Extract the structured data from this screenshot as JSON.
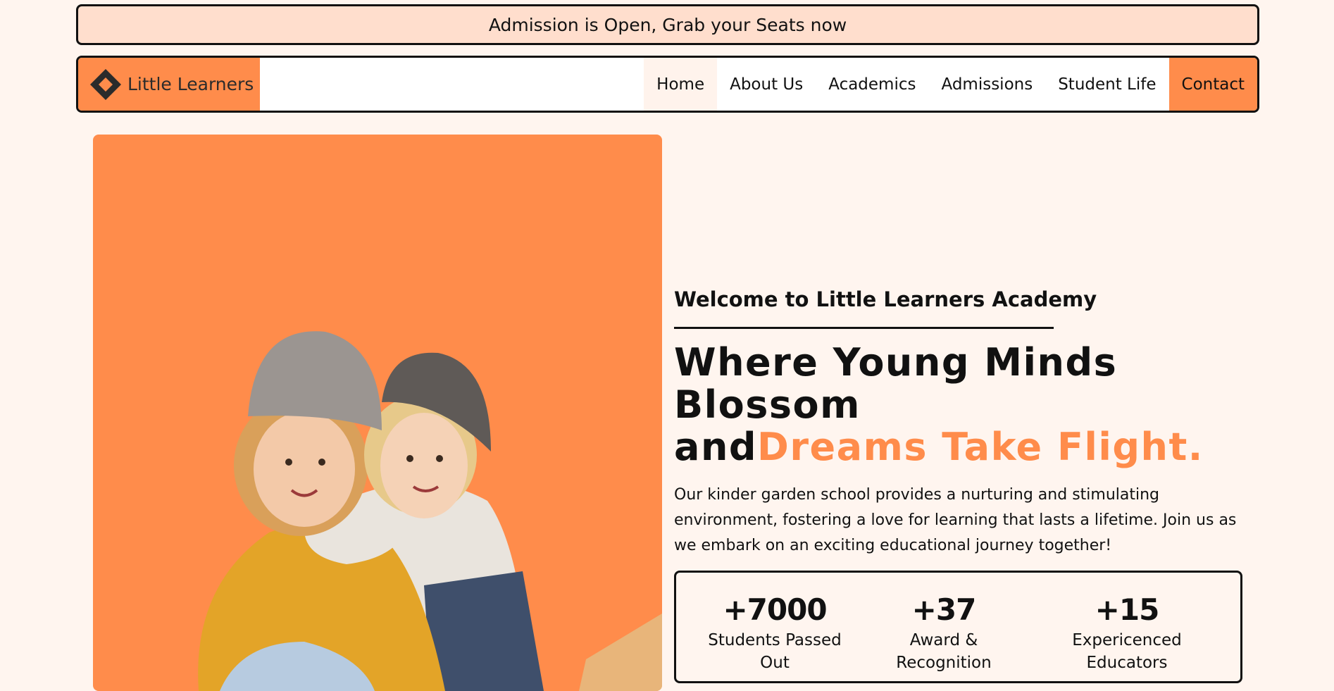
{
  "announcement": "Admission is Open, Grab your Seats now",
  "brand": {
    "name": "Little Learners",
    "accent_color": "#ff8c4b",
    "logo_icon": "diamond-logo-icon"
  },
  "nav": {
    "items": [
      "Home",
      "About Us",
      "Academics",
      "Admissions",
      "Student Life",
      "Contact"
    ],
    "active": "Home"
  },
  "hero": {
    "image_alt": "Two smiling children in knit beanies hugging",
    "welcome": "Welcome to Little Learners Academy",
    "headline_line1": "Where Young Minds",
    "headline_line2": "Blossom",
    "headline_line3_plain": "and",
    "headline_line3_accent": "Dreams Take Flight.",
    "description": "Our kinder garden school provides a nurturing and stimulating environment, fostering a love for learning that lasts a lifetime. Join us as we embark on an exciting educational journey together!"
  },
  "stats": [
    {
      "value": "+7000",
      "label": "Students Passed Out"
    },
    {
      "value": "+37",
      "label": "Award & Recognition"
    },
    {
      "value": "+15",
      "label": "Expericenced Educators"
    }
  ]
}
